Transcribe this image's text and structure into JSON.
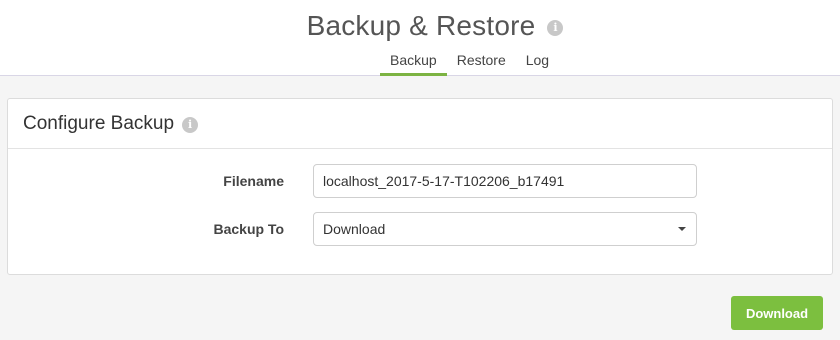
{
  "header": {
    "title": "Backup & Restore",
    "info_icon": "info-icon",
    "tabs": [
      {
        "label": "Backup",
        "active": true
      },
      {
        "label": "Restore",
        "active": false
      },
      {
        "label": "Log",
        "active": false
      }
    ]
  },
  "panel": {
    "title": "Configure Backup",
    "info_icon": "info-icon",
    "filename": {
      "label": "Filename",
      "value": "localhost_2017-5-17-T102206_b17491"
    },
    "backup_to": {
      "label": "Backup To",
      "selected": "Download"
    }
  },
  "actions": {
    "download_label": "Download"
  },
  "colors": {
    "accent": "#7cb342",
    "button": "#7cbf3f"
  }
}
